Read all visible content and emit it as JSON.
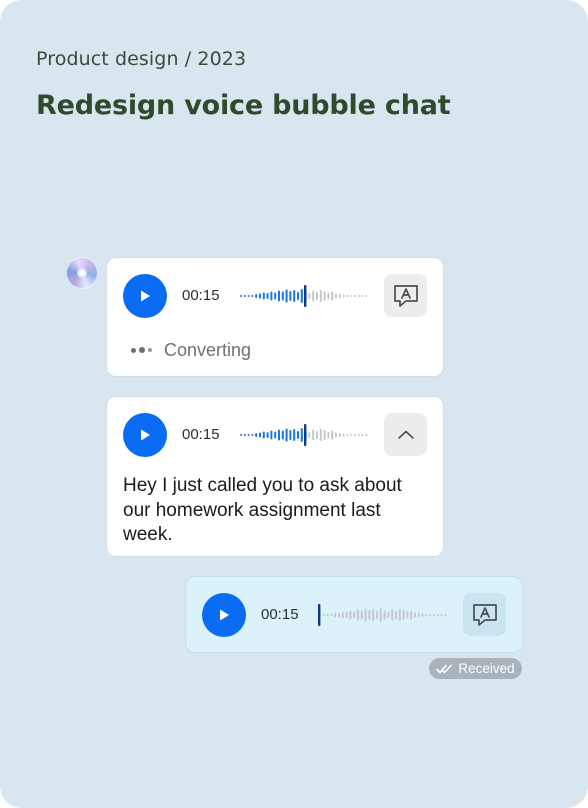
{
  "header": {
    "breadcrumb": "Product design / 2023",
    "title": "Redesign voice bubble chat"
  },
  "colors": {
    "background": "#d9e6ef",
    "play_button": "#0a6cf2",
    "title": "#2f4a2c",
    "sent_bubble": "#dcf2fb",
    "wave_played": "#1a73e8",
    "wave_unplayed": "#c4c8cc",
    "status_badge": "#a9b3bb"
  },
  "messages": [
    {
      "type": "received",
      "duration": "00:15",
      "play_icon": "play-icon",
      "action_icon": "transcribe-icon",
      "progress": 0.5,
      "status_text": "Converting"
    },
    {
      "type": "received",
      "duration": "00:15",
      "play_icon": "play-icon",
      "action_icon": "chevron-up-icon",
      "progress": 0.5,
      "transcript": "Hey I just called you to ask about our homework assignment last week."
    },
    {
      "type": "sent",
      "duration": "00:15",
      "play_icon": "play-icon",
      "action_icon": "transcribe-icon",
      "progress": 0.0,
      "delivery_status": "Received",
      "delivery_icon": "double-check-icon"
    }
  ]
}
